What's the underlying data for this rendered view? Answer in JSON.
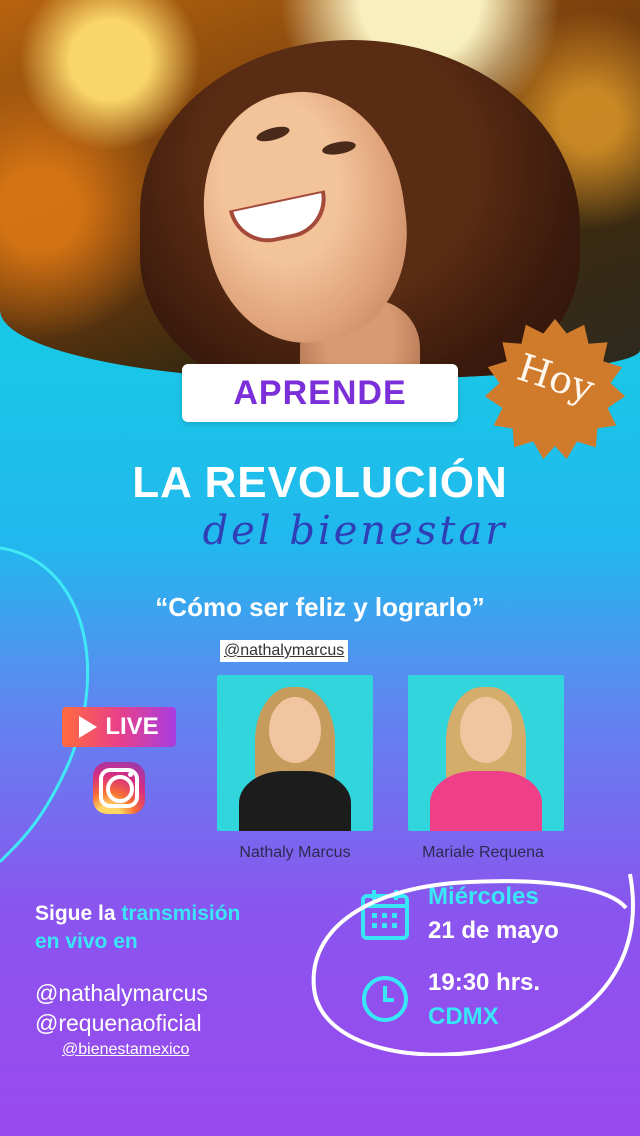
{
  "hero": {
    "alt": "smiling woman with curly hair looking up"
  },
  "badge_aprende": "APRENDE",
  "badge_hoy": "Hoy",
  "title": "LA REVOLUCIÓN",
  "subtitle": "del bienestar",
  "quote": "“Cómo ser feliz y lograrlo”",
  "top_handle": "@nathalymarcus",
  "live_label": "LIVE",
  "icons": {
    "live": "play-icon",
    "instagram": "instagram-icon",
    "calendar": "calendar-icon",
    "clock": "clock-icon"
  },
  "speakers": [
    {
      "name": "Nathaly Marcus"
    },
    {
      "name": "Mariale Requena"
    }
  ],
  "follow": {
    "line1_prefix": "Sigue la ",
    "line1_highlight": "transmisión",
    "line2": "en vivo en"
  },
  "handles": [
    "@nathalymarcus",
    "@requenaoficial"
  ],
  "bottom_handle": "@bienestamexico",
  "event": {
    "day": "Miércoles",
    "date": "21 de mayo",
    "time": "19:30 hrs.",
    "city": "CDMX"
  },
  "colors": {
    "cyan": "#39e6f5",
    "purple": "#7a2fd8",
    "hoy_badge": "#d07a2c"
  }
}
